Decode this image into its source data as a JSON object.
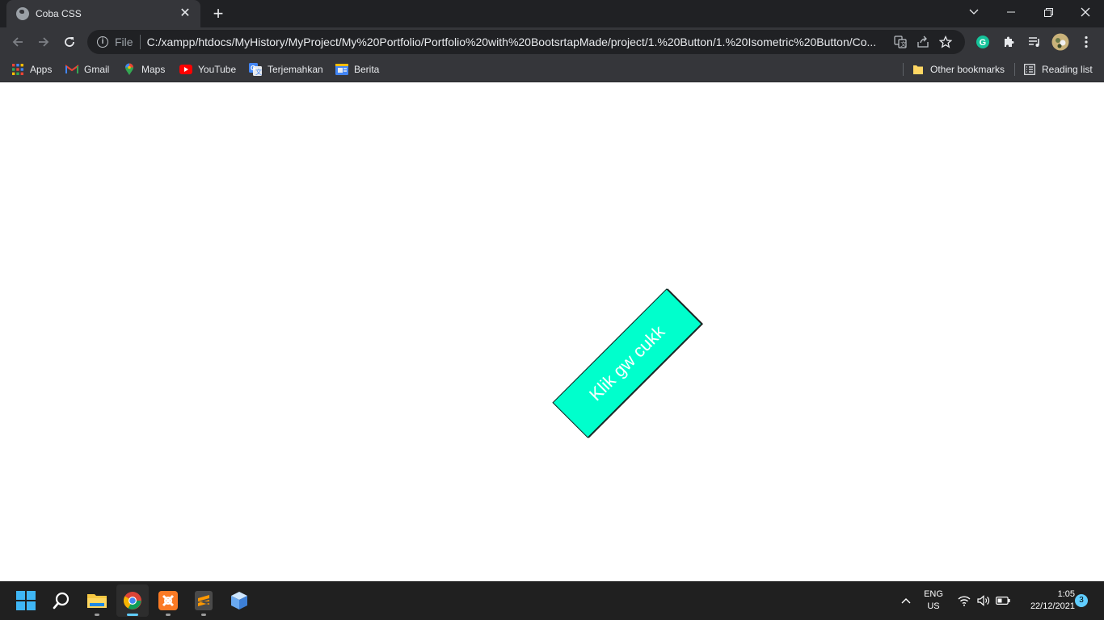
{
  "browser": {
    "tab_title": "Coba CSS",
    "address": {
      "scheme_label": "File",
      "url": "C:/xampp/htdocs/MyHistory/MyProject/My%20Portfolio/Portfolio%20with%20BootsrtapMade/project/1.%20Button/1.%20Isometric%20Button/Co..."
    },
    "bookmarks": [
      {
        "label": "Apps",
        "icon": "apps-grid-icon"
      },
      {
        "label": "Gmail",
        "icon": "gmail-icon"
      },
      {
        "label": "Maps",
        "icon": "maps-pin-icon"
      },
      {
        "label": "YouTube",
        "icon": "youtube-icon"
      },
      {
        "label": "Terjemahkan",
        "icon": "translate-icon"
      },
      {
        "label": "Berita",
        "icon": "news-icon"
      }
    ],
    "other_bookmarks": "Other bookmarks",
    "reading_list": "Reading list"
  },
  "page": {
    "button_label": "Klik gw cukk",
    "button_color": "#00ffcc"
  },
  "taskbar": {
    "language": "ENG",
    "region": "US",
    "time": "1:05",
    "date": "22/12/2021",
    "notification_count": "3"
  },
  "colors": {
    "titlebar": "#202124",
    "toolbar": "#35363a",
    "taskbar": "#202020",
    "accent": "#60cdff"
  }
}
